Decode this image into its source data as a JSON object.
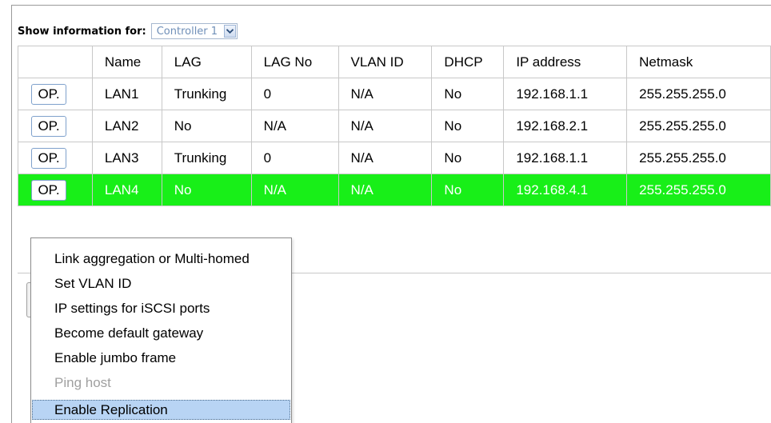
{
  "filter": {
    "label": "Show information for:",
    "selected": "Controller 1",
    "arrow_icon": "chevron-down-icon"
  },
  "table": {
    "columns": [
      "",
      "Name",
      "LAG",
      "LAG No",
      "VLAN ID",
      "DHCP",
      "IP address",
      "Netmask"
    ],
    "rows": [
      {
        "op": "OP.",
        "name": "LAN1",
        "lag": "Trunking",
        "lag_no": "0",
        "vlan_id": "N/A",
        "dhcp": "No",
        "ip": "192.168.1.1",
        "netmask": "255.255.255.0"
      },
      {
        "op": "OP.",
        "name": "LAN2",
        "lag": "No",
        "lag_no": "N/A",
        "vlan_id": "N/A",
        "dhcp": "No",
        "ip": "192.168.2.1",
        "netmask": "255.255.255.0"
      },
      {
        "op": "OP.",
        "name": "LAN3",
        "lag": "Trunking",
        "lag_no": "0",
        "vlan_id": "N/A",
        "dhcp": "No",
        "ip": "192.168.1.1",
        "netmask": "255.255.255.0"
      },
      {
        "op": "OP.",
        "name": "LAN4",
        "lag": "No",
        "lag_no": "N/A",
        "vlan_id": "N/A",
        "dhcp": "No",
        "ip": "192.168.4.1",
        "netmask": "255.255.255.0"
      }
    ],
    "selected_row": "LAN4",
    "selected_color": "#18ef18"
  },
  "menu": {
    "items": [
      {
        "label": "Link aggregation or Multi-homed",
        "state": "normal"
      },
      {
        "label": "Set VLAN ID",
        "state": "normal"
      },
      {
        "label": "IP settings for iSCSI ports",
        "state": "normal"
      },
      {
        "label": "Become default gateway",
        "state": "normal"
      },
      {
        "label": "Enable jumbo frame",
        "state": "normal"
      },
      {
        "label": "Ping host",
        "state": "disabled"
      },
      {
        "label": "Enable Replication",
        "state": "highlighted"
      }
    ]
  }
}
